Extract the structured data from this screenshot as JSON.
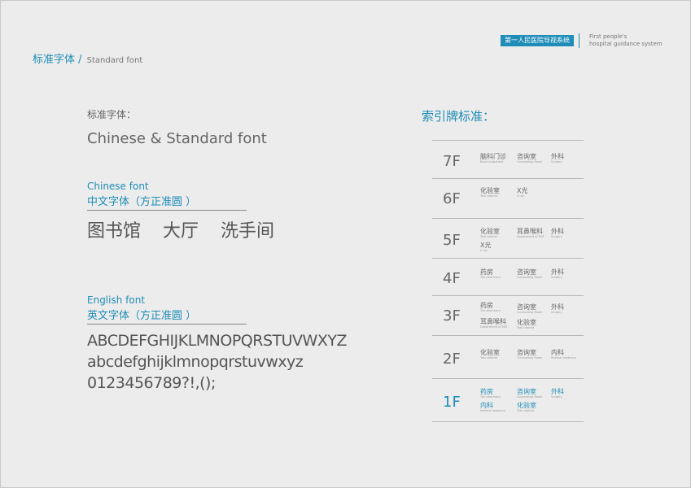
{
  "header": {
    "brand_cn": "第一人民医院导视系统",
    "brand_en_line1": "First people's",
    "brand_en_line2": "hospital guidance system"
  },
  "section": {
    "cn": "标准字体 /",
    "en": "Standard font"
  },
  "left": {
    "label": "标准字体：",
    "title": "Chinese & Standard font",
    "chinese_font": {
      "en": "Chinese font",
      "cn": "中文字体（方正准圆 ）",
      "samples": [
        "图书馆",
        "大厅",
        "洗手间"
      ]
    },
    "english_font": {
      "en": "English font",
      "cn": "英文字体（方正准圆 ）",
      "lines": [
        "ABCDEFGHIJKLMNOPQRSTUVWXYZ",
        "abcdefghijklmnopqrstuvwxyz",
        "0123456789?!,();"
      ]
    }
  },
  "index": {
    "title": "索引牌标准：",
    "floors": [
      {
        "floor": "7F",
        "items": [
          {
            "cn": "脑科门诊",
            "en": "Brain outpatient"
          },
          {
            "cn": "咨询室",
            "en": "Counselling Room"
          },
          {
            "cn": "外科",
            "en": "Surgery"
          }
        ]
      },
      {
        "floor": "6F",
        "items": [
          {
            "cn": "化验室",
            "en": "Test cabinet"
          },
          {
            "cn": "X光",
            "en": "X ray"
          }
        ]
      },
      {
        "floor": "5F",
        "items": [
          {
            "cn": "化验室",
            "en": "Test cabinet"
          },
          {
            "cn": "耳鼻喉科",
            "en": "Department of ENT"
          },
          {
            "cn": "外科",
            "en": "Surgery"
          },
          {
            "cn": "X光",
            "en": "X ray"
          }
        ]
      },
      {
        "floor": "4F",
        "items": [
          {
            "cn": "药房",
            "en": "The pharmacy"
          },
          {
            "cn": "咨询室",
            "en": "Counselling Room"
          },
          {
            "cn": "外科",
            "en": "Surgery"
          }
        ]
      },
      {
        "floor": "3F",
        "items": [
          {
            "cn": "药房",
            "en": "The pharmacy"
          },
          {
            "cn": "咨询室",
            "en": "Counselling Room"
          },
          {
            "cn": "外科",
            "en": "Surgery"
          },
          {
            "cn": "耳鼻喉科",
            "en": "Department of ENT"
          },
          {
            "cn": "化验室",
            "en": "Test cabinet"
          }
        ]
      },
      {
        "floor": "2F",
        "items": [
          {
            "cn": "化验室",
            "en": "Test cabinet"
          },
          {
            "cn": "咨询室",
            "en": "Counselling Room"
          },
          {
            "cn": "内科",
            "en": "Internal medicine"
          }
        ]
      },
      {
        "floor": "1F",
        "items": [
          {
            "cn": "药房",
            "en": "The pharmacy"
          },
          {
            "cn": "咨询室",
            "en": "Counselling Room"
          },
          {
            "cn": "外科",
            "en": "Surgery"
          },
          {
            "cn": "内科",
            "en": "Internal medicine"
          },
          {
            "cn": "化验室",
            "en": "Test cabinet"
          }
        ]
      }
    ]
  },
  "colors": {
    "accent": "#1e8db7",
    "text": "#555555",
    "background": "#ececec"
  }
}
